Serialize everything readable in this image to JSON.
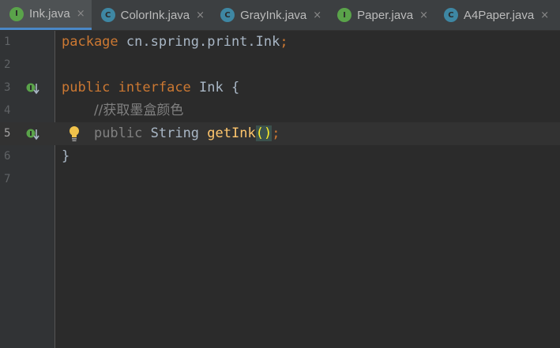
{
  "tabs": [
    {
      "label": "Ink.java",
      "icon_letter": "I",
      "icon_kind": "interface",
      "close": "×",
      "active": true
    },
    {
      "label": "ColorInk.java",
      "icon_letter": "C",
      "icon_kind": "class",
      "close": "×",
      "active": false
    },
    {
      "label": "GrayInk.java",
      "icon_letter": "C",
      "icon_kind": "class",
      "close": "×",
      "active": false
    },
    {
      "label": "Paper.java",
      "icon_letter": "I",
      "icon_kind": "interface",
      "close": "×",
      "active": false
    },
    {
      "label": "A4Paper.java",
      "icon_letter": "C",
      "icon_kind": "class",
      "close": "×",
      "active": false
    }
  ],
  "gutter": {
    "line_numbers": [
      "1",
      "2",
      "3",
      "4",
      "5",
      "6",
      "7"
    ],
    "current_line": "5",
    "implemented_marker_icon": "implemented-down-arrow-icon",
    "intention_icon": "lightbulb-icon"
  },
  "code": {
    "line1": {
      "kw": "package",
      "rest": " cn.spring.print.Ink",
      "semi": ";"
    },
    "line3": {
      "kw1": "public",
      "kw2": "interface",
      "name": "Ink",
      "brace": "{"
    },
    "line4": {
      "comment": "//获取墨盒颜色"
    },
    "line5": {
      "mod": "public",
      "type": "String",
      "method": "getInk",
      "parens": "()",
      "semi": ";"
    },
    "line6": {
      "brace": "}"
    }
  },
  "colors": {
    "keyword": "#cc7832",
    "text": "#a9b7c6",
    "comment": "#808080",
    "method": "#ffc66d",
    "background": "#2b2b2b",
    "tab_active_underline": "#4a88c7"
  }
}
